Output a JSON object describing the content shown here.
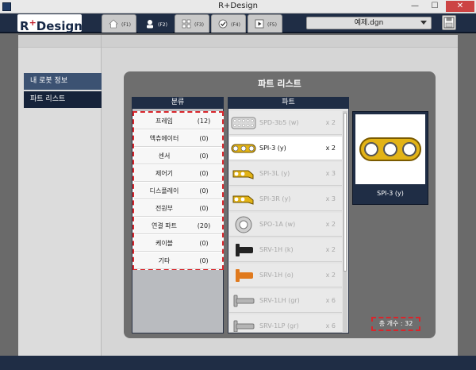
{
  "window": {
    "title": "R+Design",
    "min_glyph": "—",
    "max_glyph": "☐",
    "close_glyph": "✕"
  },
  "header": {
    "logo_text": "R",
    "logo_plus": "+",
    "logo_rest": "Design",
    "tabs": [
      {
        "key": "(F1)",
        "icon": "home-icon"
      },
      {
        "key": "(F2)",
        "icon": "robot-info-icon"
      },
      {
        "key": "(F3)",
        "icon": "parts-grid-icon"
      },
      {
        "key": "(F4)",
        "icon": "check-settings-icon"
      },
      {
        "key": "(F5)",
        "icon": "play-icon"
      }
    ],
    "active_tab_index": 1,
    "file_name": "예제.dgn",
    "save_icon": "save-icon"
  },
  "sidebar": {
    "items": [
      {
        "label": "내 로봇 정보"
      },
      {
        "label": "파트 리스트"
      }
    ]
  },
  "parts_panel": {
    "title": "파트 리스트",
    "category_header": "분류",
    "parts_header": "파트",
    "categories": [
      {
        "name": "프레임",
        "count": "(12)"
      },
      {
        "name": "액츄에이터",
        "count": "(0)"
      },
      {
        "name": "센서",
        "count": "(0)"
      },
      {
        "name": "제어기",
        "count": "(0)"
      },
      {
        "name": "디스플레이",
        "count": "(0)"
      },
      {
        "name": "전원부",
        "count": "(0)"
      },
      {
        "name": "연결 파트",
        "count": "(20)"
      },
      {
        "name": "케이블",
        "count": "(0)"
      },
      {
        "name": "기타",
        "count": "(0)"
      }
    ],
    "parts": [
      {
        "name": "SPD-3b5 (w)",
        "qty": "x 2",
        "icon": "plate-icon",
        "color": "#d9d9d9"
      },
      {
        "name": "SPI-3 (y)",
        "qty": "x 2",
        "icon": "link-3-hole-icon",
        "color": "#e2b316"
      },
      {
        "name": "SPI-3L (y)",
        "qty": "x 3",
        "icon": "link-bent-icon",
        "color": "#e2b316"
      },
      {
        "name": "SPI-3R (y)",
        "qty": "x 3",
        "icon": "link-bent-icon",
        "color": "#e2b316"
      },
      {
        "name": "SPO-1A (w)",
        "qty": "x 2",
        "icon": "ring-icon",
        "color": "#cfcfcf"
      },
      {
        "name": "SRV-1H (k)",
        "qty": "x 2",
        "icon": "rivet-icon",
        "color": "#222222"
      },
      {
        "name": "SRV-1H (o)",
        "qty": "x 2",
        "icon": "rivet-icon",
        "color": "#e07a1e"
      },
      {
        "name": "SRV-1LH (gr)",
        "qty": "x 6",
        "icon": "rivet-long-icon",
        "color": "#b5b5b5"
      },
      {
        "name": "SRV-1LP (gr)",
        "qty": "x 6",
        "icon": "rivet-long-icon",
        "color": "#b5b5b5"
      }
    ],
    "selected_part_index": 1,
    "preview_caption": "SPI-3 (y)",
    "total_label": "총 개수 :",
    "total_value": "32"
  }
}
